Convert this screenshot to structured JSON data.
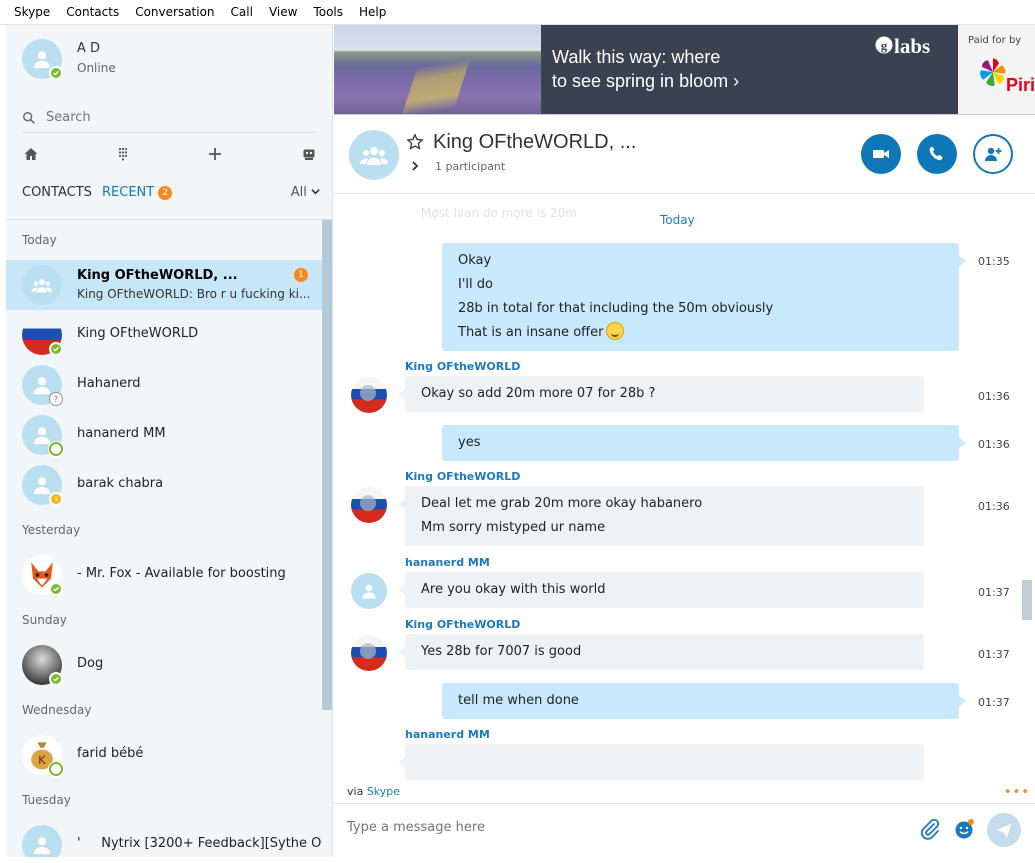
{
  "menu": [
    "Skype",
    "Contacts",
    "Conversation",
    "Call",
    "View",
    "Tools",
    "Help"
  ],
  "profile": {
    "name": "A D",
    "status": "Online"
  },
  "search": {
    "placeholder": "Search"
  },
  "tabs": {
    "contacts": "CONTACTS",
    "recent": "RECENT",
    "recent_badge": "2",
    "filter": "All"
  },
  "sections": {
    "today": "Today",
    "yesterday": "Yesterday",
    "sunday": "Sunday",
    "wednesday": "Wednesday",
    "tuesday": "Tuesday"
  },
  "recent": [
    {
      "name": "King OFtheWORLD, ...",
      "preview": "King OFtheWORLD: Bro r u fucking ki...",
      "badge": "1"
    },
    {
      "name": "King OFtheWORLD"
    },
    {
      "name": "Hahanerd"
    },
    {
      "name": "hananerd MM"
    },
    {
      "name": "barak chabra"
    },
    {
      "name": "- Mr. Fox - Available for boosting"
    },
    {
      "name": "Dog"
    },
    {
      "name": "farid bébé"
    },
    {
      "name": "'     Nytrix [3200+ Feedback][Sythe O..."
    }
  ],
  "ad": {
    "headline1": "Walk this way: where",
    "headline2": "to see spring in bloom",
    "arrow": "›",
    "logo": "labs",
    "paid_label": "Paid for by",
    "sponsor_partial": "Piri"
  },
  "chat": {
    "title": "King OFtheWORLD, ...",
    "participants": "1 participant",
    "ghost_text": "Most Ivan do more is 20m",
    "day": "Today",
    "messages": [
      {
        "lines": [
          "Okay",
          "I'll do",
          "28b in total for that including the 50m obviously",
          "That is an insane offer"
        ],
        "time": "01:35"
      },
      {
        "sender": "King OFtheWORLD",
        "lines": [
          "Okay so add 20m more 07 for 28b ?"
        ],
        "time": "01:36"
      },
      {
        "lines": [
          "yes"
        ],
        "time": "01:36"
      },
      {
        "sender": "King OFtheWORLD",
        "lines": [
          "Deal let me grab 20m more okay habanero",
          "Mm sorry mistyped ur name"
        ],
        "time": "01:36"
      },
      {
        "sender": "hananerd MM",
        "lines": [
          "Are you okay with this world"
        ],
        "time": "01:37"
      },
      {
        "sender": "King OFtheWORLD",
        "lines": [
          "Yes 28b for 7007 is good"
        ],
        "time": "01:37"
      },
      {
        "lines": [
          "tell me when done"
        ],
        "time": "01:37"
      },
      {
        "sender": "hananerd MM"
      }
    ]
  },
  "compose": {
    "via_prefix": "via",
    "via_link": "Skype",
    "placeholder": "Type a message here",
    "dots": "•••"
  },
  "colors": {
    "accent": "#0f77b8",
    "badge": "#f6891f",
    "online": "#7cbb2f",
    "outgoing": "#c7e9fb"
  }
}
